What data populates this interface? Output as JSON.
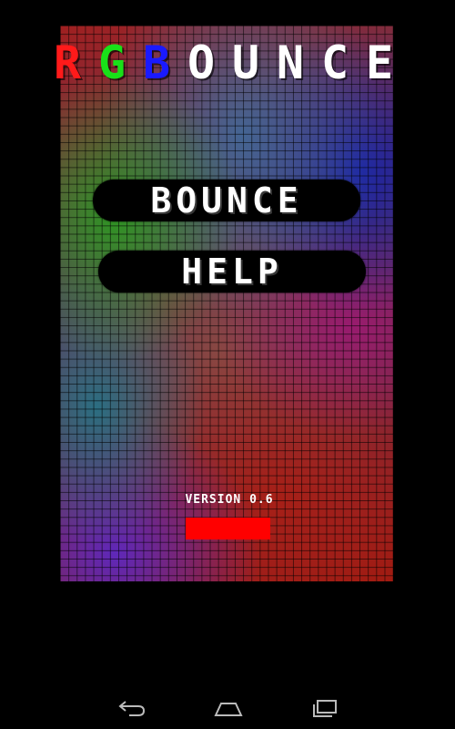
{
  "title": {
    "letters": [
      {
        "char": "R",
        "color": "#ff1a1a"
      },
      {
        "char": "G",
        "color": "#19e019"
      },
      {
        "char": "B",
        "color": "#1a1aff"
      },
      {
        "char": "O",
        "color": "#ffffff"
      },
      {
        "char": "U",
        "color": "#ffffff"
      },
      {
        "char": "N",
        "color": "#ffffff"
      },
      {
        "char": "C",
        "color": "#ffffff"
      },
      {
        "char": "E",
        "color": "#ffffff"
      }
    ]
  },
  "menu": {
    "bounce_label": "BOUNCE",
    "help_label": "HELP"
  },
  "version_text": "VERSION 0.6",
  "paddle": {
    "color": "#ff0000"
  },
  "navbar": {
    "back_icon": "back-icon",
    "home_icon": "home-icon",
    "recent_icon": "recent-apps-icon"
  }
}
